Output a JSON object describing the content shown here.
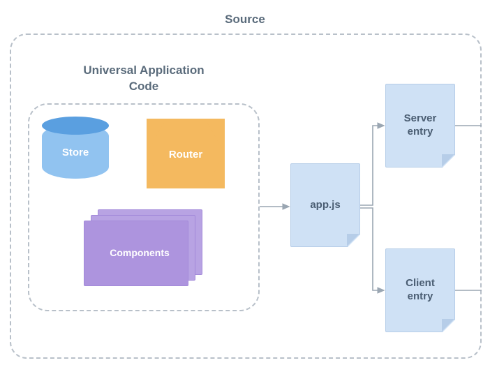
{
  "source_title": "Source",
  "uac_title": "Universal\nApplication Code",
  "nodes": {
    "store": {
      "label": "Store"
    },
    "router": {
      "label": "Router"
    },
    "components": {
      "label": "Components"
    },
    "appjs": {
      "label": "app.js"
    },
    "server_entry": {
      "label": "Server\nentry"
    },
    "client_entry": {
      "label": "Client\nentry"
    }
  },
  "edges": [
    {
      "from": "uac-box",
      "to": "appjs"
    },
    {
      "from": "appjs",
      "to": "server_entry"
    },
    {
      "from": "appjs",
      "to": "client_entry"
    },
    {
      "from": "server_entry",
      "to": "outside-right"
    },
    {
      "from": "client_entry",
      "to": "outside-right"
    }
  ],
  "colors": {
    "dash_border": "#b8c0c9",
    "file_bg": "#cfe1f5",
    "file_border": "#b6cde8",
    "store": "#91c3f0",
    "store_top": "#5a9fe0",
    "router": "#f4b95f",
    "components": "#b8a3e3",
    "text": "#5a6b7b"
  }
}
